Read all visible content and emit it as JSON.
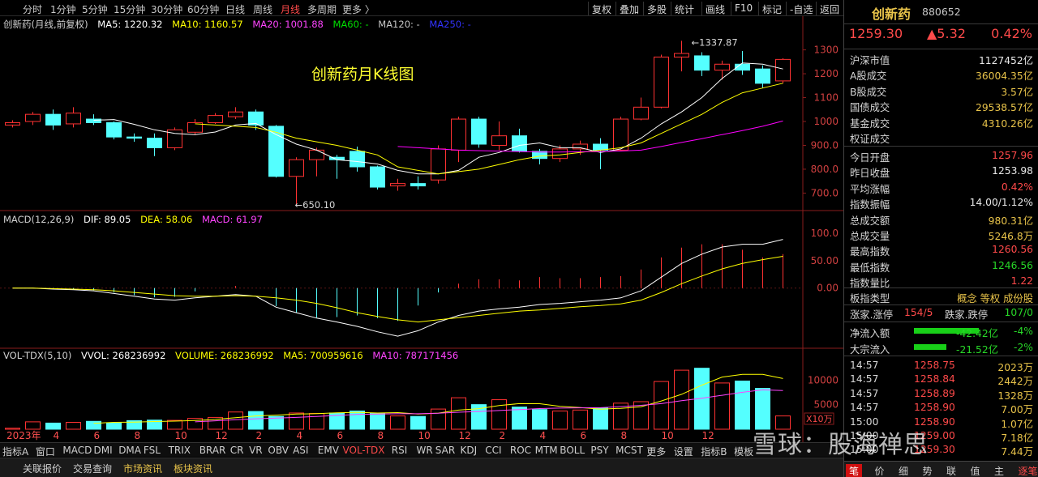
{
  "toolbar": {
    "periods": [
      "分时",
      "1分钟",
      "5分钟",
      "15分钟",
      "30分钟",
      "60分钟",
      "日线",
      "周线",
      "月线",
      "多周期",
      "更多 〉"
    ],
    "active_period": "月线",
    "right_tools": [
      "复权",
      "叠加",
      "多股",
      "统计",
      "画线",
      "F10",
      "标记",
      "-自选",
      "返回"
    ]
  },
  "chart_title": "创新药月K线图",
  "main_legend": {
    "name": "创新药(月线,前复权)",
    "ma5": "MA5: 1220.32",
    "ma10": "MA10: 1160.57",
    "ma20": "MA20: 1001.88",
    "ma60": "MA60: -",
    "ma120": "MA120: -",
    "ma250": "MA250: -"
  },
  "annotations": {
    "high": "1337.87",
    "low": "650.10"
  },
  "macd_legend": {
    "name": "MACD(12,26,9)",
    "dif": "DIF: 89.05",
    "dea": "DEA: 58.06",
    "macd": "MACD: 61.97"
  },
  "vol_legend": {
    "name": "VOL-TDX(5,10)",
    "vvol": "VVOL: 268236992",
    "volume": "VOLUME: 268236992",
    "ma5": "MA5: 700959616",
    "ma10": "MA10: 787171456"
  },
  "vol_unit": "X10万",
  "price_axis": [
    "1300",
    "1200",
    "1100",
    "1000",
    "900.0",
    "800.0",
    "700.0"
  ],
  "macd_axis": [
    "100.0",
    "50.00",
    "0.00"
  ],
  "vol_axis": [
    "10000",
    "5000"
  ],
  "x_axis": [
    "2023年",
    "4",
    "6",
    "8",
    "10",
    "12",
    "2",
    "4",
    "6",
    "8",
    "10",
    "12",
    "2",
    "4",
    "6",
    "8",
    "10",
    "12"
  ],
  "chart_data": {
    "type": "candlestick",
    "title": "创新药月K线图",
    "frequency": "monthly",
    "candles": [
      {
        "o": 985,
        "c": 995,
        "h": 1005,
        "l": 975
      },
      {
        "o": 1000,
        "c": 1030,
        "h": 1040,
        "l": 985
      },
      {
        "o": 1030,
        "c": 985,
        "h": 1050,
        "l": 965
      },
      {
        "o": 990,
        "c": 1035,
        "h": 1060,
        "l": 975
      },
      {
        "o": 1010,
        "c": 995,
        "h": 1030,
        "l": 985
      },
      {
        "o": 995,
        "c": 935,
        "h": 1000,
        "l": 925
      },
      {
        "o": 935,
        "c": 930,
        "h": 950,
        "l": 915
      },
      {
        "o": 930,
        "c": 890,
        "h": 950,
        "l": 855
      },
      {
        "o": 890,
        "c": 965,
        "h": 975,
        "l": 880
      },
      {
        "o": 955,
        "c": 995,
        "h": 1010,
        "l": 945
      },
      {
        "o": 995,
        "c": 1025,
        "h": 1035,
        "l": 990
      },
      {
        "o": 1020,
        "c": 1040,
        "h": 1060,
        "l": 1010
      },
      {
        "o": 1040,
        "c": 985,
        "h": 1050,
        "l": 965
      },
      {
        "o": 980,
        "c": 770,
        "h": 985,
        "l": 765
      },
      {
        "o": 770,
        "c": 840,
        "h": 850,
        "l": 650.1
      },
      {
        "o": 840,
        "c": 880,
        "h": 890,
        "l": 770
      },
      {
        "o": 850,
        "c": 840,
        "h": 860,
        "l": 760
      },
      {
        "o": 875,
        "c": 810,
        "h": 895,
        "l": 790
      },
      {
        "o": 810,
        "c": 725,
        "h": 815,
        "l": 715
      },
      {
        "o": 730,
        "c": 740,
        "h": 760,
        "l": 710
      },
      {
        "o": 740,
        "c": 730,
        "h": 770,
        "l": 715
      },
      {
        "o": 755,
        "c": 885,
        "h": 900,
        "l": 740
      },
      {
        "o": 880,
        "c": 1010,
        "h": 1020,
        "l": 830
      },
      {
        "o": 1010,
        "c": 905,
        "h": 1020,
        "l": 890
      },
      {
        "o": 900,
        "c": 940,
        "h": 1000,
        "l": 880
      },
      {
        "o": 940,
        "c": 875,
        "h": 970,
        "l": 870
      },
      {
        "o": 875,
        "c": 845,
        "h": 885,
        "l": 820
      },
      {
        "o": 845,
        "c": 885,
        "h": 900,
        "l": 830
      },
      {
        "o": 885,
        "c": 905,
        "h": 920,
        "l": 860
      },
      {
        "o": 905,
        "c": 880,
        "h": 930,
        "l": 800
      },
      {
        "o": 880,
        "c": 1010,
        "h": 1020,
        "l": 875
      },
      {
        "o": 1010,
        "c": 1060,
        "h": 1100,
        "l": 1005
      },
      {
        "o": 1060,
        "c": 1270,
        "h": 1280,
        "l": 1055
      },
      {
        "o": 1270,
        "c": 1285,
        "h": 1337.87,
        "l": 1210
      },
      {
        "o": 1275,
        "c": 1215,
        "h": 1290,
        "l": 1190
      },
      {
        "o": 1215,
        "c": 1240,
        "h": 1255,
        "l": 1175
      },
      {
        "o": 1240,
        "c": 1215,
        "h": 1295,
        "l": 1195
      },
      {
        "o": 1220,
        "c": 1160,
        "h": 1235,
        "l": 1140
      },
      {
        "o": 1170,
        "c": 1260,
        "h": 1265,
        "l": 1160
      }
    ],
    "ma5": [
      null,
      null,
      null,
      null,
      1005,
      1008,
      988,
      965,
      950,
      945,
      956,
      985,
      992,
      945,
      905,
      880,
      840,
      832,
      822,
      795,
      780,
      780,
      795,
      850,
      870,
      900,
      910,
      890,
      890,
      870,
      885,
      930,
      990,
      1040,
      1100,
      1180,
      1245,
      1240,
      1220
    ],
    "ma10": [
      null,
      null,
      null,
      null,
      null,
      null,
      null,
      null,
      null,
      990,
      985,
      980,
      975,
      955,
      930,
      915,
      900,
      880,
      860,
      810,
      795,
      780,
      790,
      800,
      820,
      840,
      855,
      860,
      870,
      880,
      890,
      910,
      950,
      990,
      1030,
      1080,
      1120,
      1140,
      1160
    ],
    "ma20": [
      null,
      null,
      null,
      null,
      null,
      null,
      null,
      null,
      null,
      null,
      null,
      null,
      null,
      null,
      null,
      null,
      null,
      null,
      null,
      895,
      890,
      885,
      880,
      878,
      876,
      874,
      872,
      872,
      873,
      874,
      876,
      880,
      895,
      912,
      928,
      945,
      962,
      980,
      1002
    ],
    "macd": {
      "dif": [
        0,
        0,
        -2,
        -3,
        -5,
        -10,
        -15,
        -20,
        -22,
        -18,
        -15,
        -12,
        -15,
        -35,
        -45,
        -55,
        -62,
        -70,
        -80,
        -88,
        -78,
        -62,
        -50,
        -42,
        -38,
        -35,
        -30,
        -28,
        -25,
        -22,
        -18,
        -5,
        20,
        45,
        62,
        75,
        80,
        80,
        89
      ],
      "dea": [
        0,
        0,
        -1,
        -2,
        -3,
        -5,
        -8,
        -11,
        -14,
        -15,
        -15,
        -14,
        -15,
        -18,
        -22,
        -28,
        -36,
        -45,
        -52,
        -58,
        -62,
        -58,
        -54,
        -50,
        -46,
        -42,
        -40,
        -37,
        -34,
        -32,
        -29,
        -22,
        -8,
        8,
        22,
        35,
        45,
        52,
        58
      ],
      "bar": [
        0,
        0,
        -2,
        -3,
        -4,
        -8,
        -13,
        -17,
        -16,
        -6,
        0,
        4,
        0,
        -33,
        -45,
        -54,
        -53,
        -50,
        -55,
        -60,
        -32,
        -8,
        8,
        16,
        16,
        14,
        20,
        18,
        18,
        20,
        22,
        34,
        56,
        74,
        80,
        80,
        70,
        56,
        62
      ]
    },
    "volume": [
      200,
      1500,
      1250,
      1400,
      1600,
      1250,
      1750,
      1850,
      1800,
      2200,
      2400,
      3500,
      3600,
      2600,
      3300,
      3200,
      3300,
      3700,
      3300,
      2700,
      2600,
      4100,
      6400,
      5000,
      6000,
      4500,
      4000,
      3700,
      3900,
      4300,
      5300,
      5600,
      9700,
      12000,
      12400,
      9400,
      9800,
      8300,
      2700
    ],
    "vol_ma5": [
      null,
      null,
      null,
      null,
      1200,
      1400,
      1450,
      1570,
      1650,
      1770,
      2000,
      2350,
      2700,
      2860,
      3080,
      3160,
      3320,
      3440,
      3300,
      3380,
      3100,
      3280,
      3880,
      4180,
      4820,
      5200,
      5180,
      4640,
      4420,
      4080,
      4240,
      4580,
      5740,
      7100,
      8960,
      10600,
      11160,
      11160,
      10300
    ],
    "vol_ma10": [
      null,
      null,
      null,
      null,
      null,
      null,
      null,
      null,
      null,
      1490,
      1720,
      1920,
      2130,
      2250,
      2400,
      2600,
      2800,
      3000,
      3100,
      3150,
      3150,
      3250,
      3450,
      3600,
      3800,
      4000,
      4200,
      4300,
      4350,
      4380,
      4600,
      4850,
      5200,
      5800,
      6300,
      6900,
      7500,
      8000,
      7870
    ],
    "price_ylim": [
      620,
      1380
    ],
    "macd_ylim": [
      -110,
      115
    ],
    "vol_ylim": [
      0,
      13500
    ]
  },
  "sidebar": {
    "name": "创新药",
    "code": "880652",
    "price": "1259.30",
    "change": "▲5.32",
    "pct": "0.42%",
    "rows1": [
      {
        "k": "沪深市值",
        "v": "1127452亿",
        "c": "#e8e8e8"
      },
      {
        "k": "A股成交",
        "v": "36004.35亿",
        "c": "#e8c34a"
      },
      {
        "k": "B股成交",
        "v": "3.57亿",
        "c": "#e8c34a"
      },
      {
        "k": "国债成交",
        "v": "29538.57亿",
        "c": "#e8c34a"
      },
      {
        "k": "基金成交",
        "v": "4310.26亿",
        "c": "#e8c34a"
      },
      {
        "k": "权证成交",
        "v": "",
        "c": "#e8c34a"
      }
    ],
    "rows2": [
      {
        "k": "今日开盘",
        "v": "1257.96",
        "c": "#ff4a4a"
      },
      {
        "k": "昨日收盘",
        "v": "1253.98",
        "c": "#e8e8e8"
      },
      {
        "k": "平均涨幅",
        "v": "0.42%",
        "c": "#ff4a4a"
      },
      {
        "k": "指数振幅",
        "v": "14.00/1.12%",
        "c": "#e8e8e8"
      },
      {
        "k": "总成交额",
        "v": "980.31亿",
        "c": "#e8c34a"
      },
      {
        "k": "总成交量",
        "v": "5246.8万",
        "c": "#e8c34a"
      },
      {
        "k": "最高指数",
        "v": "1260.56",
        "c": "#ff4a4a"
      },
      {
        "k": "最低指数",
        "v": "1246.56",
        "c": "#28d728"
      },
      {
        "k": "指数量比",
        "v": "1.22",
        "c": "#ff4a4a"
      }
    ],
    "sector_type_label": "板指类型",
    "sector_type_value": "概念 等权 成份股",
    "updown": {
      "k1": "涨家.涨停",
      "v1": "154/5",
      "k2": "跌家.跌停",
      "v2": "107/0"
    },
    "flows": [
      {
        "k": "净流入额",
        "v": "-42.42亿",
        "p": "-4%",
        "w": 80
      },
      {
        "k": "大宗流入",
        "v": "-21.52亿",
        "p": "-2%",
        "w": 40
      }
    ],
    "ticks": [
      {
        "t": "14:57",
        "p": "1258.75",
        "q": "2023万"
      },
      {
        "t": "14:57",
        "p": "1258.84",
        "q": "2442万"
      },
      {
        "t": "14:57",
        "p": "1258.89",
        "q": "1328万"
      },
      {
        "t": "14:57",
        "p": "1258.90",
        "q": "7.00万"
      },
      {
        "t": "15:00",
        "p": "1258.90",
        "q": "1.07亿"
      },
      {
        "t": "15:00",
        "p": "1259.00",
        "q": "7.18亿"
      },
      {
        "t": "15:00",
        "p": "1259.30",
        "q": "7.44万"
      }
    ],
    "bottom_tabs": [
      "笔",
      "价",
      "细",
      "势",
      "联",
      "值",
      "主",
      "逐笔"
    ]
  },
  "indicator_tabs": [
    "指标A",
    "窗口",
    "MACD",
    "DMI",
    "DMA",
    "FSL",
    "TRIX",
    "BRAR",
    "CR",
    "VR",
    "OBV",
    "ASI",
    "EMV",
    "VOL-TDX",
    "RSI",
    "WR",
    "SAR",
    "KDJ",
    "CCI",
    "ROC",
    "MTM",
    "BOLL",
    "PSY",
    "MCST",
    "更多",
    "设置",
    "指标B",
    "模板"
  ],
  "active_indicator": "VOL-TDX",
  "bottom_links": [
    "关联报价",
    "交易查询",
    "市场资讯",
    "板块资讯"
  ],
  "watermark": "雪球：股海禅思",
  "colors": {
    "up": "#ff3232",
    "down": "#54ffff",
    "ma5": "#ffffff",
    "ma10": "#ffff00",
    "ma20": "#ff00ff",
    "ma60": "#00e000",
    "grid": "#8a1d1d"
  }
}
